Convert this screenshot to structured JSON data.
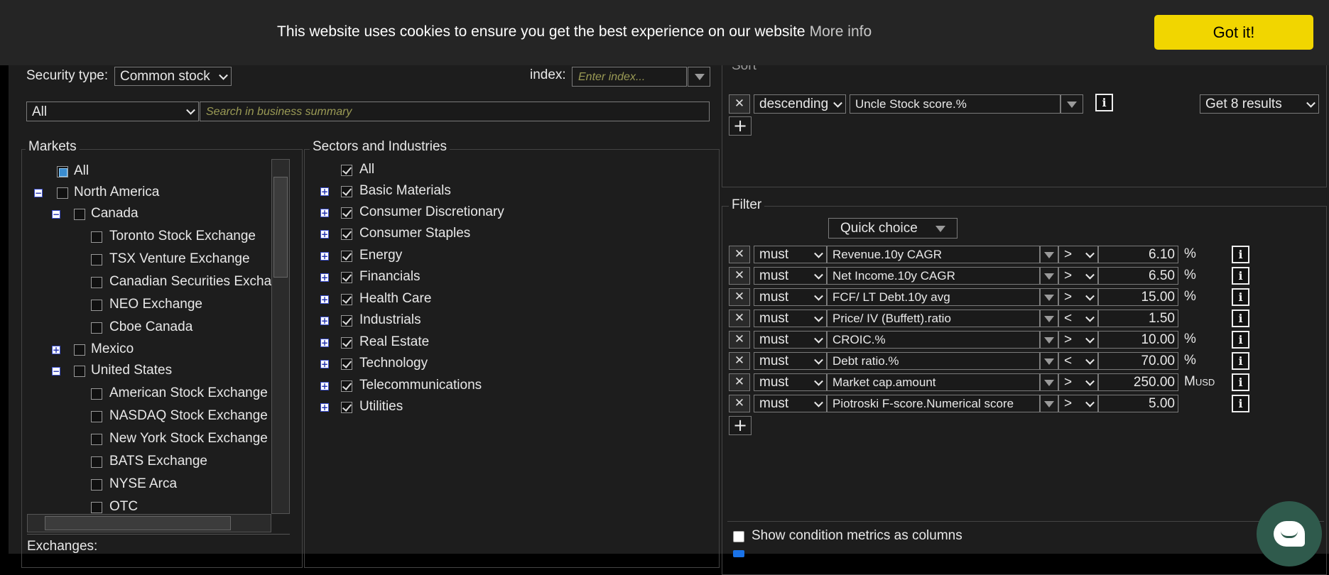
{
  "cookie": {
    "message": "This website uses cookies to ensure you get the best experience on our website",
    "more_info": "More info",
    "button": "Got it!",
    "button_color": "#f1d600"
  },
  "security": {
    "label": "Security type:",
    "value": "Common stock"
  },
  "index": {
    "label": "index:",
    "placeholder": "Enter index..."
  },
  "summary": {
    "scope_value": "All",
    "placeholder": "Search in business summary"
  },
  "markets": {
    "legend": "Markets",
    "all": "All",
    "north_america": "North America",
    "canada": "Canada",
    "canada_items": [
      "Toronto Stock Exchange",
      "TSX Venture Exchange",
      "Canadian Securities Exchange",
      "NEO Exchange",
      "Cboe Canada"
    ],
    "mexico": "Mexico",
    "united_states": "United States",
    "us_items": [
      "American Stock Exchange",
      "NASDAQ Stock Exchange",
      "New York Stock Exchange",
      "BATS Exchange",
      "NYSE Arca",
      "OTC"
    ],
    "toggle_expanded": "−",
    "toggle_collapsed": "+"
  },
  "exchanges_label": "Exchanges:",
  "sectors": {
    "legend": "Sectors and Industries",
    "all": "All",
    "items": [
      "Basic Materials",
      "Consumer Discretionary",
      "Consumer Staples",
      "Energy",
      "Financials",
      "Health Care",
      "Industrials",
      "Real Estate",
      "Technology",
      "Telecommunications",
      "Utilities"
    ]
  },
  "sort": {
    "legend": "Sort",
    "order": "descending",
    "metric": "Uncle Stock score.%",
    "results": "Get 8 results",
    "remove": "✕",
    "info": "i",
    "add": "+"
  },
  "filter": {
    "legend": "Filter",
    "quick_choice": "Quick choice",
    "rows": [
      {
        "mode": "must",
        "metric": "Revenue.10y CAGR",
        "op": ">",
        "value": "6.10",
        "unit": "%"
      },
      {
        "mode": "must",
        "metric": "Net Income.10y CAGR",
        "op": ">",
        "value": "6.50",
        "unit": "%"
      },
      {
        "mode": "must",
        "metric": "FCF/ LT Debt.10y avg",
        "op": ">",
        "value": "15.00",
        "unit": "%"
      },
      {
        "mode": "must",
        "metric": "Price/ IV (Buffett).ratio",
        "op": "<",
        "value": "1.50",
        "unit": ""
      },
      {
        "mode": "must",
        "metric": "CROIC.%",
        "op": ">",
        "value": "10.00",
        "unit": "%"
      },
      {
        "mode": "must",
        "metric": "Debt ratio.%",
        "op": "<",
        "value": "70.00",
        "unit": "%"
      },
      {
        "mode": "must",
        "metric": "Market cap.amount",
        "op": ">",
        "value": "250.00",
        "unit": "M",
        "unit_sub": "USD"
      },
      {
        "mode": "must",
        "metric": "Piotroski F-score.Numerical score",
        "op": ">",
        "value": "5.00",
        "unit": ""
      }
    ]
  },
  "options": {
    "show_columns": "Show condition metrics as columns"
  }
}
